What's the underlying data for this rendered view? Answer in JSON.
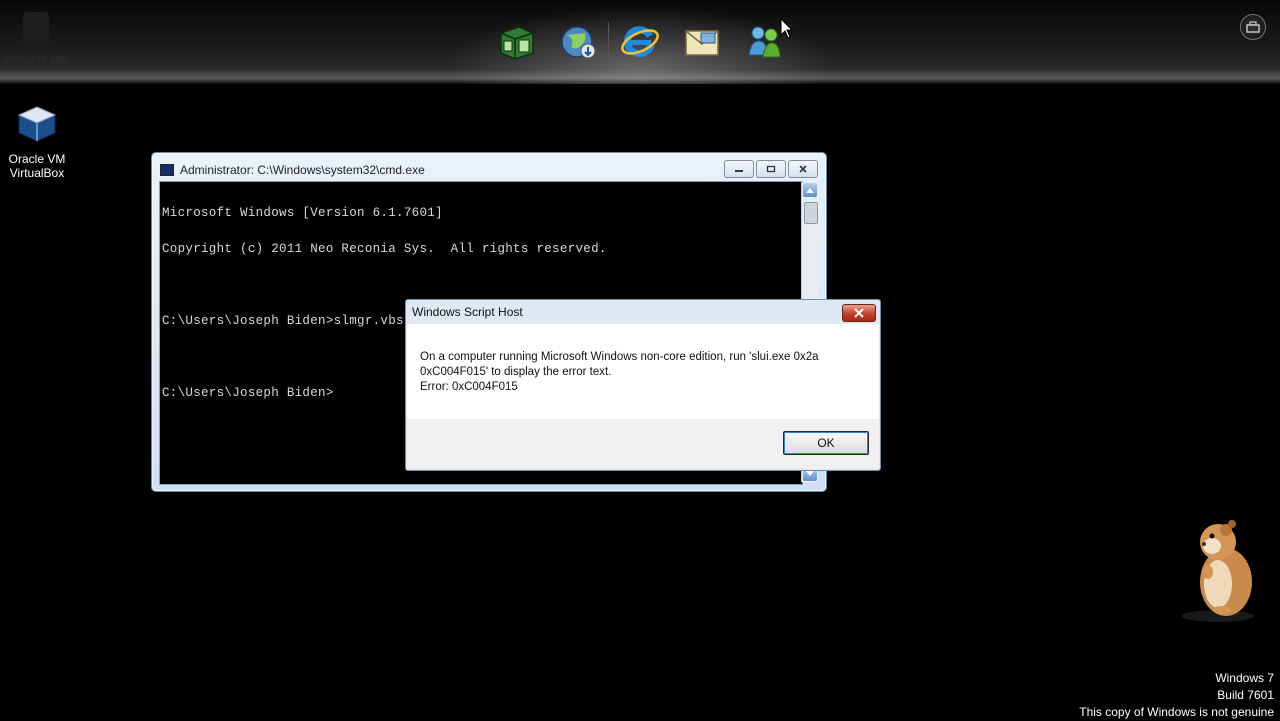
{
  "dock": {
    "ghost_label": "Recycle Bin",
    "icons": [
      "media-center-icon",
      "network-globe-icon",
      "internet-explorer-icon",
      "mail-icon",
      "messenger-icon"
    ]
  },
  "desktop": {
    "icons": [
      {
        "label_line1": "Oracle VM",
        "label_line2": "VirtualBox"
      }
    ]
  },
  "cmd_window": {
    "title": "Administrator: C:\\Windows\\system32\\cmd.exe",
    "lines": [
      "Microsoft Windows [Version 6.1.7601]",
      "Copyright (c) 2011 Neo Reconia Sys.  All rights reserved.",
      "",
      "C:\\Users\\Joseph Biden>slmgr.vbs /ipk FJ82H-XT6CR-J8D7P-XQJJ2-GPDD4",
      "",
      "C:\\Users\\Joseph Biden>"
    ]
  },
  "dialog": {
    "title": "Windows Script Host",
    "message_line1": "On a computer running Microsoft Windows non-core edition, run 'slui.exe 0x2a",
    "message_line2": "0xC004F015' to display the error text.",
    "message_line3": "Error: 0xC004F015",
    "ok_label": "OK"
  },
  "watermark": {
    "line1": "Windows 7",
    "line2": "Build 7601",
    "line3": "This copy of Windows is not genuine"
  },
  "colors": {
    "desktop_bg": "#000000",
    "console_text": "#d8d8d8",
    "close_red": "#c0402a"
  }
}
